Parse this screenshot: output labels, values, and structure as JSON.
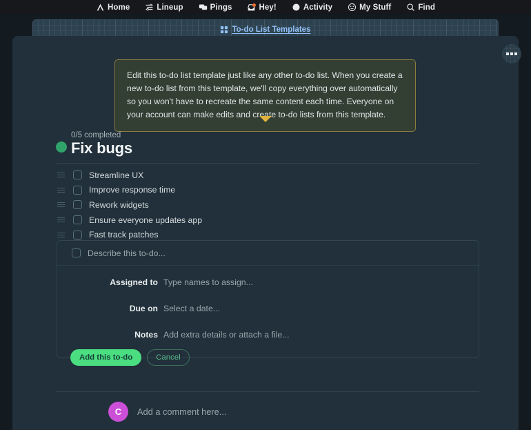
{
  "nav": {
    "items": [
      {
        "label": "Home",
        "icon": "home-icon"
      },
      {
        "label": "Lineup",
        "icon": "lineup-icon"
      },
      {
        "label": "Pings",
        "icon": "pings-icon"
      },
      {
        "label": "Hey!",
        "icon": "hey-inbox-icon",
        "badge": true
      },
      {
        "label": "Activity",
        "icon": "activity-moon-icon"
      },
      {
        "label": "My Stuff",
        "icon": "smiley-icon"
      },
      {
        "label": "Find",
        "icon": "search-icon"
      }
    ]
  },
  "breadcrumb": {
    "icon": "grid-squares-icon",
    "label": "To-do List Templates"
  },
  "callout": {
    "text": "Edit this to-do list template just like any other to-do list. When you create a new to-do list from this template, we'll copy everything over automatically so you won't have to recreate the same content each time. Everyone on your account can make edits and create to-do lists from this template."
  },
  "list": {
    "completed": "0/5 completed",
    "title": "Fix bugs",
    "items": [
      {
        "label": "Streamline UX"
      },
      {
        "label": "Improve response time"
      },
      {
        "label": "Rework widgets"
      },
      {
        "label": "Ensure everyone updates app"
      },
      {
        "label": "Fast track patches"
      }
    ]
  },
  "new_todo": {
    "describe_placeholder": "Describe this to-do...",
    "assigned_label": "Assigned to",
    "assigned_placeholder": "Type names to assign...",
    "due_label": "Due on",
    "due_placeholder": "Select a date...",
    "notes_label": "Notes",
    "notes_placeholder": "Add extra details or attach a file...",
    "add_label": "Add this to-do",
    "cancel_label": "Cancel"
  },
  "comment": {
    "avatar_initial": "C",
    "placeholder": "Add a comment here..."
  },
  "colors": {
    "page_bg": "#131a20",
    "card_bg": "#21303a",
    "nav_bg": "#16181c",
    "band_bg": "#2d4250",
    "link": "#93c0f5",
    "callout_bg": "#333f33",
    "callout_border": "#8a7c41",
    "arrow": "#e0b33e",
    "accent_green": "#4ade80",
    "status_dot": "#2fa36a",
    "avatar": "#cc4fd8",
    "badge": "#f06a2b"
  }
}
